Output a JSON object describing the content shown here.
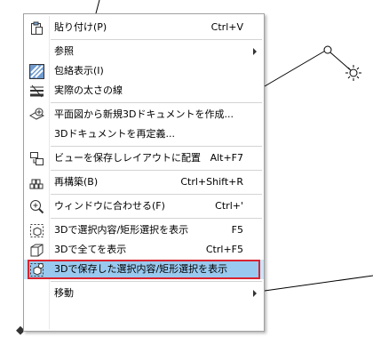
{
  "menu": {
    "items": [
      {
        "label": "貼り付け(P)",
        "shortcut": "Ctrl+V",
        "icon": "paste-icon"
      },
      {
        "label": "参照",
        "submenu": true
      },
      {
        "label": "包絡表示(I)",
        "icon": "envelope-display-icon"
      },
      {
        "label": "実際の太さの線",
        "icon": "actual-line-weight-icon"
      },
      {
        "label": "平面図から新規3Dドキュメントを作成...",
        "icon": "new-3d-document-icon"
      },
      {
        "label": "3Dドキュメントを再定義..."
      },
      {
        "label": "ビューを保存しレイアウトに配置",
        "shortcut": "Alt+F7",
        "icon": "save-view-layout-icon"
      },
      {
        "label": "再構築(B)",
        "shortcut": "Ctrl+Shift+R",
        "icon": "rebuild-icon"
      },
      {
        "label": "ウィンドウに合わせる(F)",
        "shortcut": "Ctrl+'",
        "icon": "fit-in-window-icon"
      },
      {
        "label": "3Dで選択内容/矩形選択を表示",
        "shortcut": "F5",
        "icon": "show-selection-3d-icon"
      },
      {
        "label": "3Dで全てを表示",
        "shortcut": "Ctrl+F5",
        "icon": "show-all-3d-icon"
      },
      {
        "label": "3Dで保存した選択内容/矩形選択を表示",
        "icon": "show-saved-selection-3d-icon"
      },
      {
        "label": "移動",
        "submenu": true
      }
    ]
  },
  "colors": {
    "highlight": "#99c9ef",
    "highlight_border": "#d9232f",
    "separator": "#d4d4d4"
  }
}
